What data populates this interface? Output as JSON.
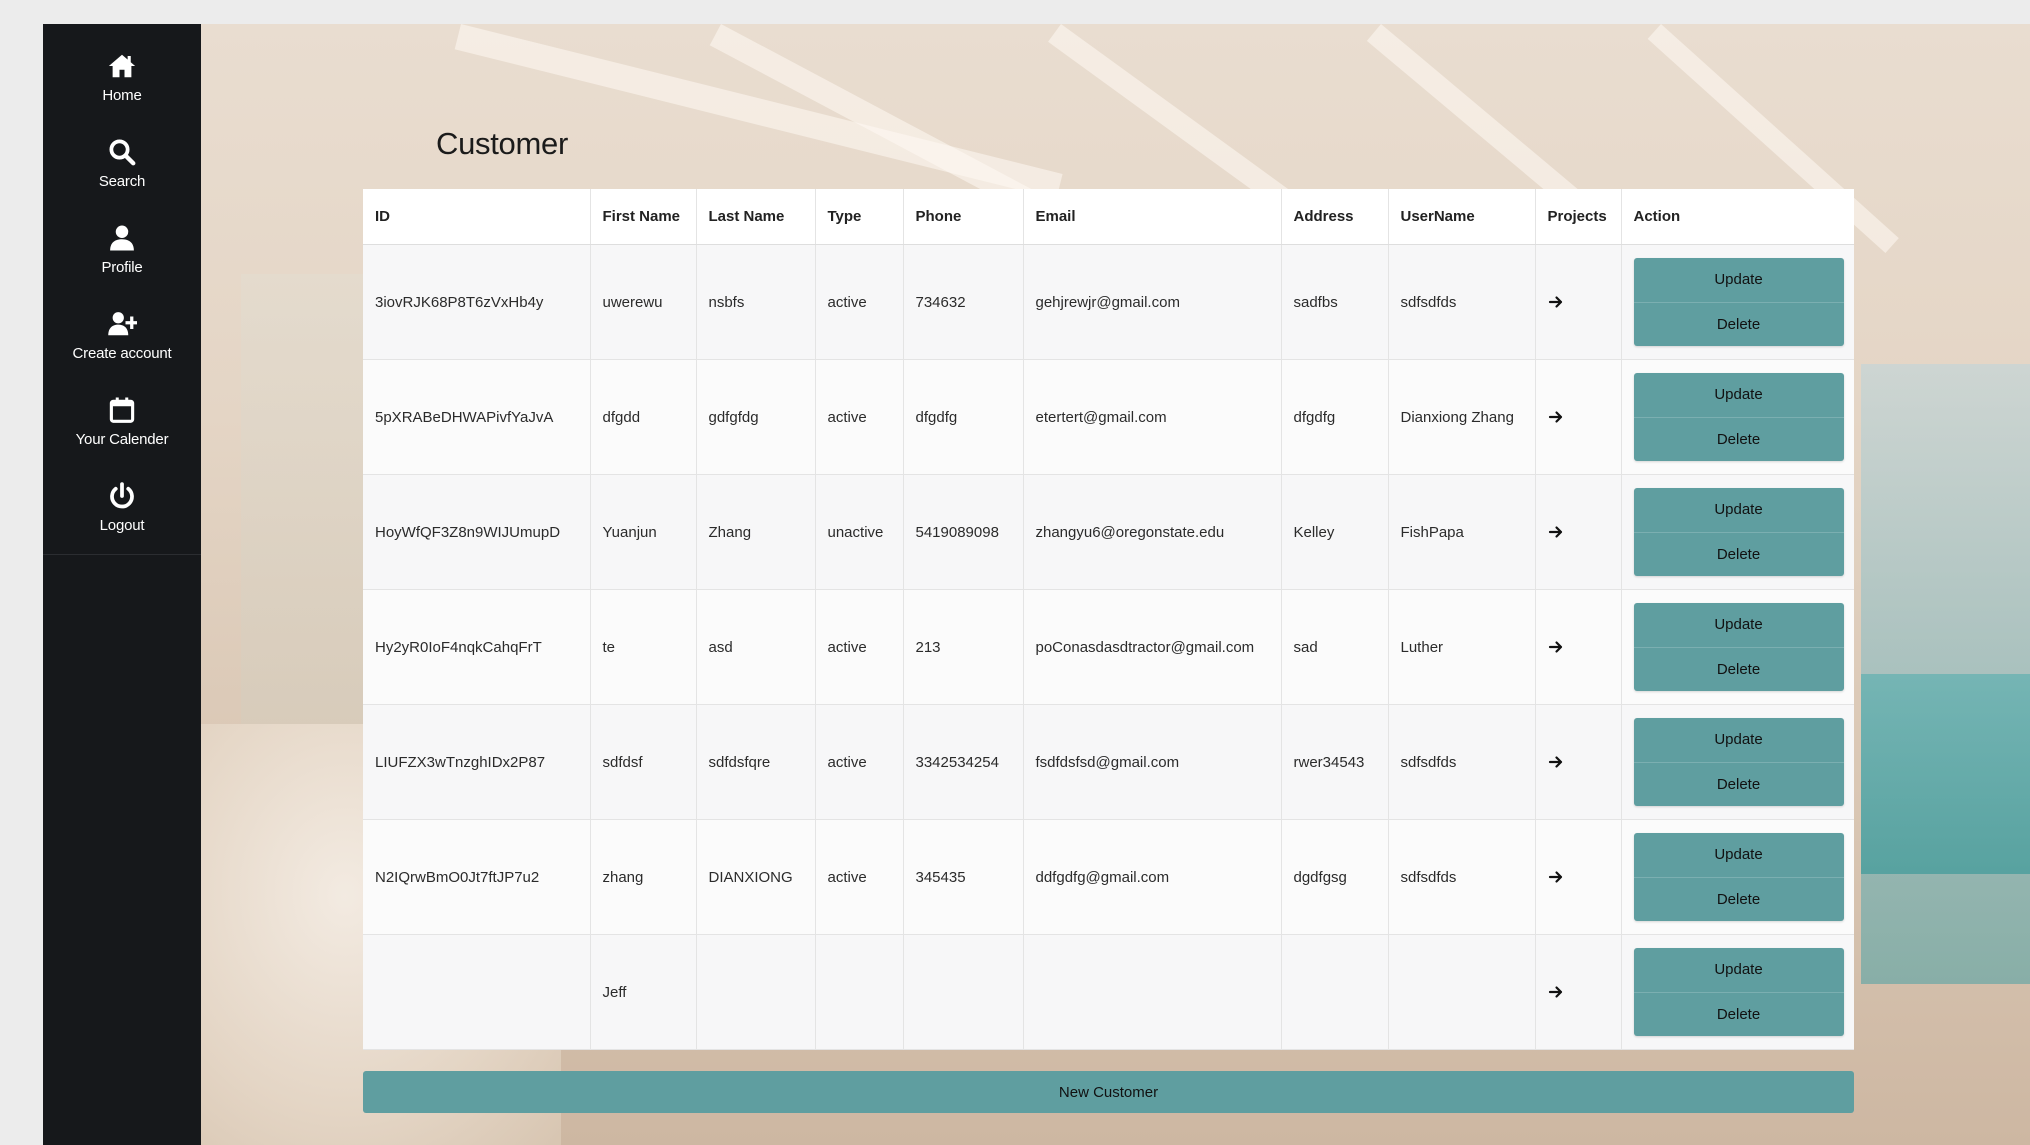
{
  "sidebar": {
    "items": [
      {
        "label": "Home",
        "icon": "home-icon"
      },
      {
        "label": "Search",
        "icon": "search-icon"
      },
      {
        "label": "Profile",
        "icon": "user-icon"
      },
      {
        "label": "Create account",
        "icon": "user-plus-icon"
      },
      {
        "label": "Your Calender",
        "icon": "calendar-icon"
      },
      {
        "label": "Logout",
        "icon": "power-icon"
      }
    ]
  },
  "page": {
    "title": "Customer"
  },
  "table": {
    "headers": [
      "ID",
      "First Name",
      "Last Name",
      "Type",
      "Phone",
      "Email",
      "Address",
      "UserName",
      "Projects",
      "Action"
    ],
    "rows": [
      {
        "id": "3iovRJK68P8T6zVxHb4y",
        "first": "uwerewu",
        "last": "nsbfs",
        "type": "active",
        "phone": "734632",
        "email": "gehjrewjr@gmail.com",
        "address": "sadfbs",
        "username": "sdfsdfds"
      },
      {
        "id": "5pXRABeDHWAPivfYaJvA",
        "first": "dfgdd",
        "last": "gdfgfdg",
        "type": "active",
        "phone": "dfgdfg",
        "email": "etertert@gmail.com",
        "address": "dfgdfg",
        "username": "Dianxiong Zhang"
      },
      {
        "id": "HoyWfQF3Z8n9WIJUmupD",
        "first": "Yuanjun",
        "last": "Zhang",
        "type": "unactive",
        "phone": "5419089098",
        "email": "zhangyu6@oregonstate.edu",
        "address": "Kelley",
        "username": "FishPapa"
      },
      {
        "id": "Hy2yR0IoF4nqkCahqFrT",
        "first": "te",
        "last": "asd",
        "type": "active",
        "phone": "213",
        "email": "poConasdasdtractor@gmail.com",
        "address": "sad",
        "username": "Luther"
      },
      {
        "id": "LIUFZX3wTnzghIDx2P87",
        "first": "sdfdsf",
        "last": "sdfdsfqre",
        "type": "active",
        "phone": "3342534254",
        "email": "fsdfdsfsd@gmail.com",
        "address": "rwer34543",
        "username": "sdfsdfds"
      },
      {
        "id": "N2IQrwBmO0Jt7ftJP7u2",
        "first": "zhang",
        "last": "DIANXIONG",
        "type": "active",
        "phone": "345435",
        "email": "ddfgdfg@gmail.com",
        "address": "dgdfgsg",
        "username": "sdfsdfds"
      },
      {
        "id": "",
        "first": "Jeff",
        "last": "",
        "type": "",
        "phone": "",
        "email": "",
        "address": "",
        "username": ""
      }
    ],
    "projects_icon": "arrow-right-icon",
    "update_label": "Update",
    "delete_label": "Delete"
  },
  "new_customer_label": "New Customer",
  "colors": {
    "sidebar": "#16181b",
    "accent": "#5f9ea0"
  }
}
